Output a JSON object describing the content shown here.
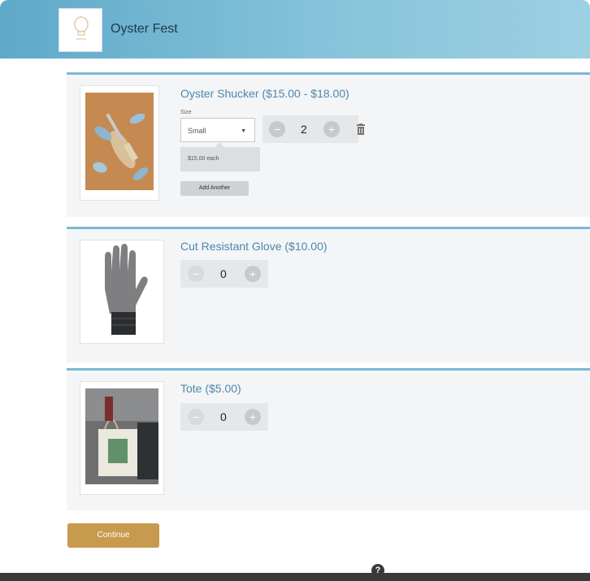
{
  "header": {
    "title": "Oyster Fest",
    "logo_icon": "lightbulb-logo-icon"
  },
  "products": [
    {
      "title": "Oyster Shucker ($15.00 - $18.00)",
      "size_label": "Size",
      "size_selected": "Small",
      "quantity": "2",
      "price_each": "$15.00 each",
      "add_another_label": "Add Another",
      "image": "oyster-shucker-image"
    },
    {
      "title": "Cut Resistant Glove ($10.00)",
      "quantity": "0",
      "image": "glove-image"
    },
    {
      "title": "Tote ($5.00)",
      "quantity": "0",
      "image": "tote-bag-image"
    }
  ],
  "continue_label": "Continue",
  "colors": {
    "header_gradient_start": "#5ea9c9",
    "card_accent": "#7bb8d4",
    "title_text": "#4a88ad",
    "continue_button": "#c89a4d"
  }
}
